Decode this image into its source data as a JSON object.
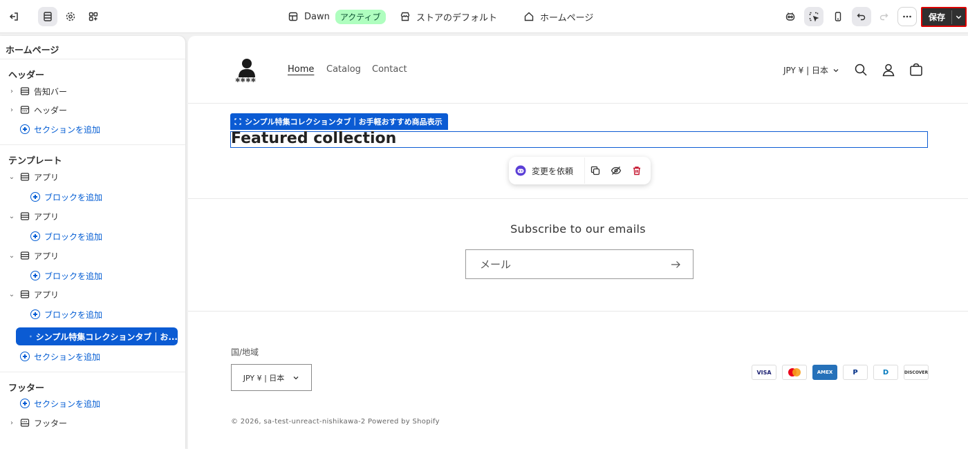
{
  "topbar": {
    "theme_name": "Dawn",
    "theme_status": "アクティブ",
    "store_default": "ストアのデフォルト",
    "page": "ホームページ",
    "save_label": "保存"
  },
  "sidebar": {
    "title": "ホームページ",
    "header_group": "ヘッダー",
    "announcement_bar": "告知バー",
    "header": "ヘッダー",
    "add_section": "セクションを追加",
    "template_group": "テンプレート",
    "app": "アプリ",
    "add_block": "ブロックを追加",
    "selected_section": "シンプル特集コレクションタブ｜お...",
    "footer_group": "フッター",
    "footer": "フッター"
  },
  "store": {
    "nav": [
      "Home",
      "Catalog",
      "Contact"
    ],
    "currency": "JPY ¥ | 日本",
    "selection_tag": "シンプル特集コレクションタブ｜お手軽おすすめ商品表示",
    "featured_title": "Featured collection",
    "request_change": "変更を依頼",
    "subscribe_title": "Subscribe to our emails",
    "email_placeholder": "メール",
    "region_label": "国/地域",
    "region_value": "JPY ¥ | 日本",
    "copyright": "© 2026, sa-test-unreact-nishikawa-2 Powered by Shopify",
    "payments": [
      "VISA",
      "MC",
      "AMEX",
      "P",
      "D",
      "DISCOVER"
    ]
  }
}
